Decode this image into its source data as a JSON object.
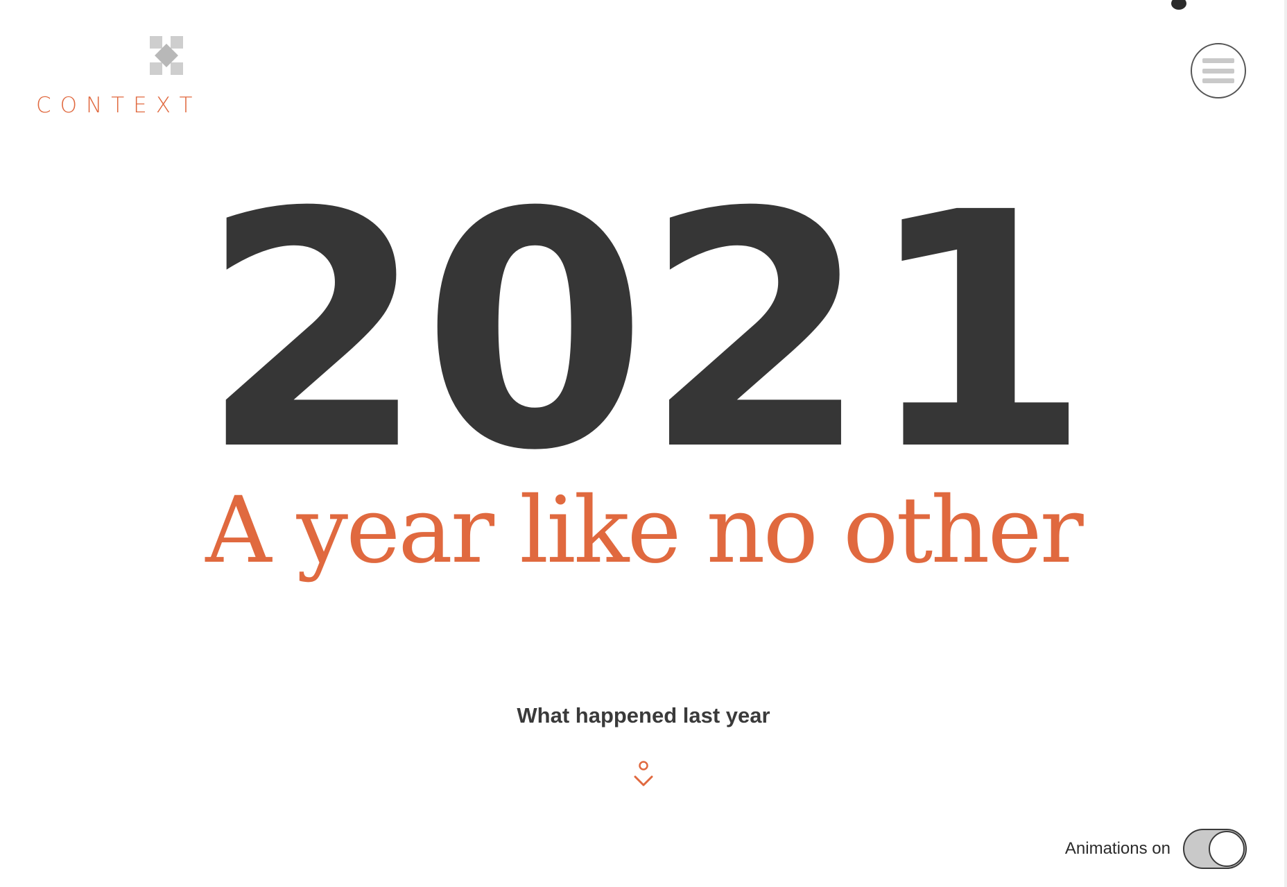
{
  "brand": {
    "name": "CONTEXT",
    "mark_icon": "x-cross-logo-icon",
    "accent_color": "#e0693f",
    "mark_color": "#c9c9c9"
  },
  "header": {
    "menu_icon": "hamburger-menu-icon"
  },
  "hero": {
    "year": "2021",
    "tagline": "A year like no other",
    "year_color": "#363636"
  },
  "cta": {
    "label": "What happened last year",
    "scroll_icon": "scroll-down-arrow-icon"
  },
  "settings": {
    "animations_label": "Animations on",
    "animations_enabled": true
  }
}
